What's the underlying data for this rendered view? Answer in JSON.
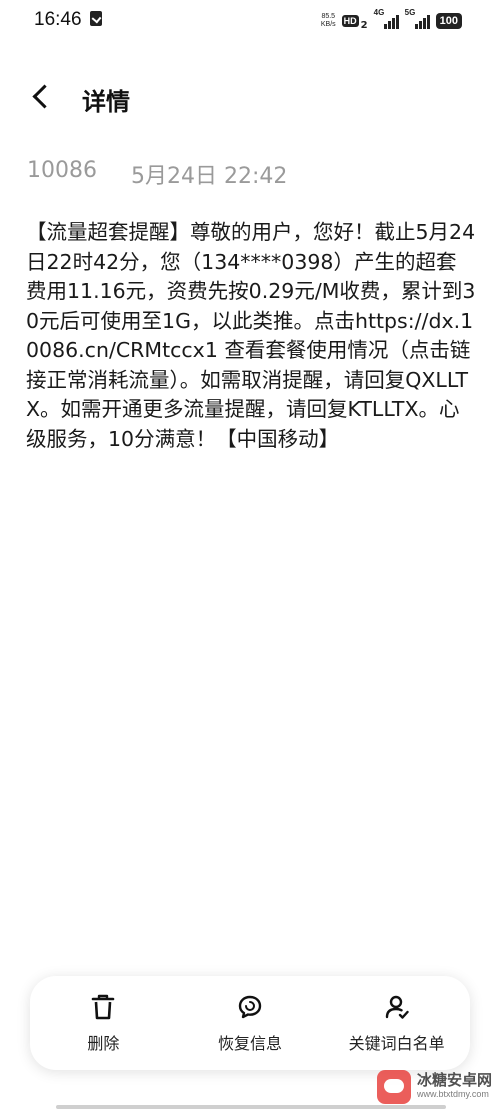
{
  "status_bar": {
    "time": "16:46",
    "net_speed_value": "85.5",
    "net_speed_unit": "KB/s",
    "hd_label": "HD",
    "hd_sub": "2",
    "network_1": "4G",
    "network_2": "5G",
    "battery": "100"
  },
  "header": {
    "title": "详情"
  },
  "message": {
    "sender": "10086",
    "datetime": "5月24日 22:42",
    "body": "【流量超套提醒】尊敬的用户，您好！截止5月24日22时42分，您（134****0398）产生的超套费用11.16元，资费先按0.29元/M收费，累计到30元后可使用至1G，以此类推。点击https://dx.10086.cn/CRMtccx1 查看套餐使用情况（点击链接正常消耗流量）。如需取消提醒，请回复QXLLTX。如需开通更多流量提醒，请回复KTLLTX。心级服务，10分满意！【中国移动】"
  },
  "actions": [
    {
      "label": "删除",
      "icon": "trash-icon"
    },
    {
      "label": "恢复信息",
      "icon": "restore-message-icon"
    },
    {
      "label": "关键词白名单",
      "icon": "user-check-icon"
    }
  ],
  "watermark": {
    "name": "冰糖安卓网",
    "url": "www.btxtdmy.com"
  }
}
